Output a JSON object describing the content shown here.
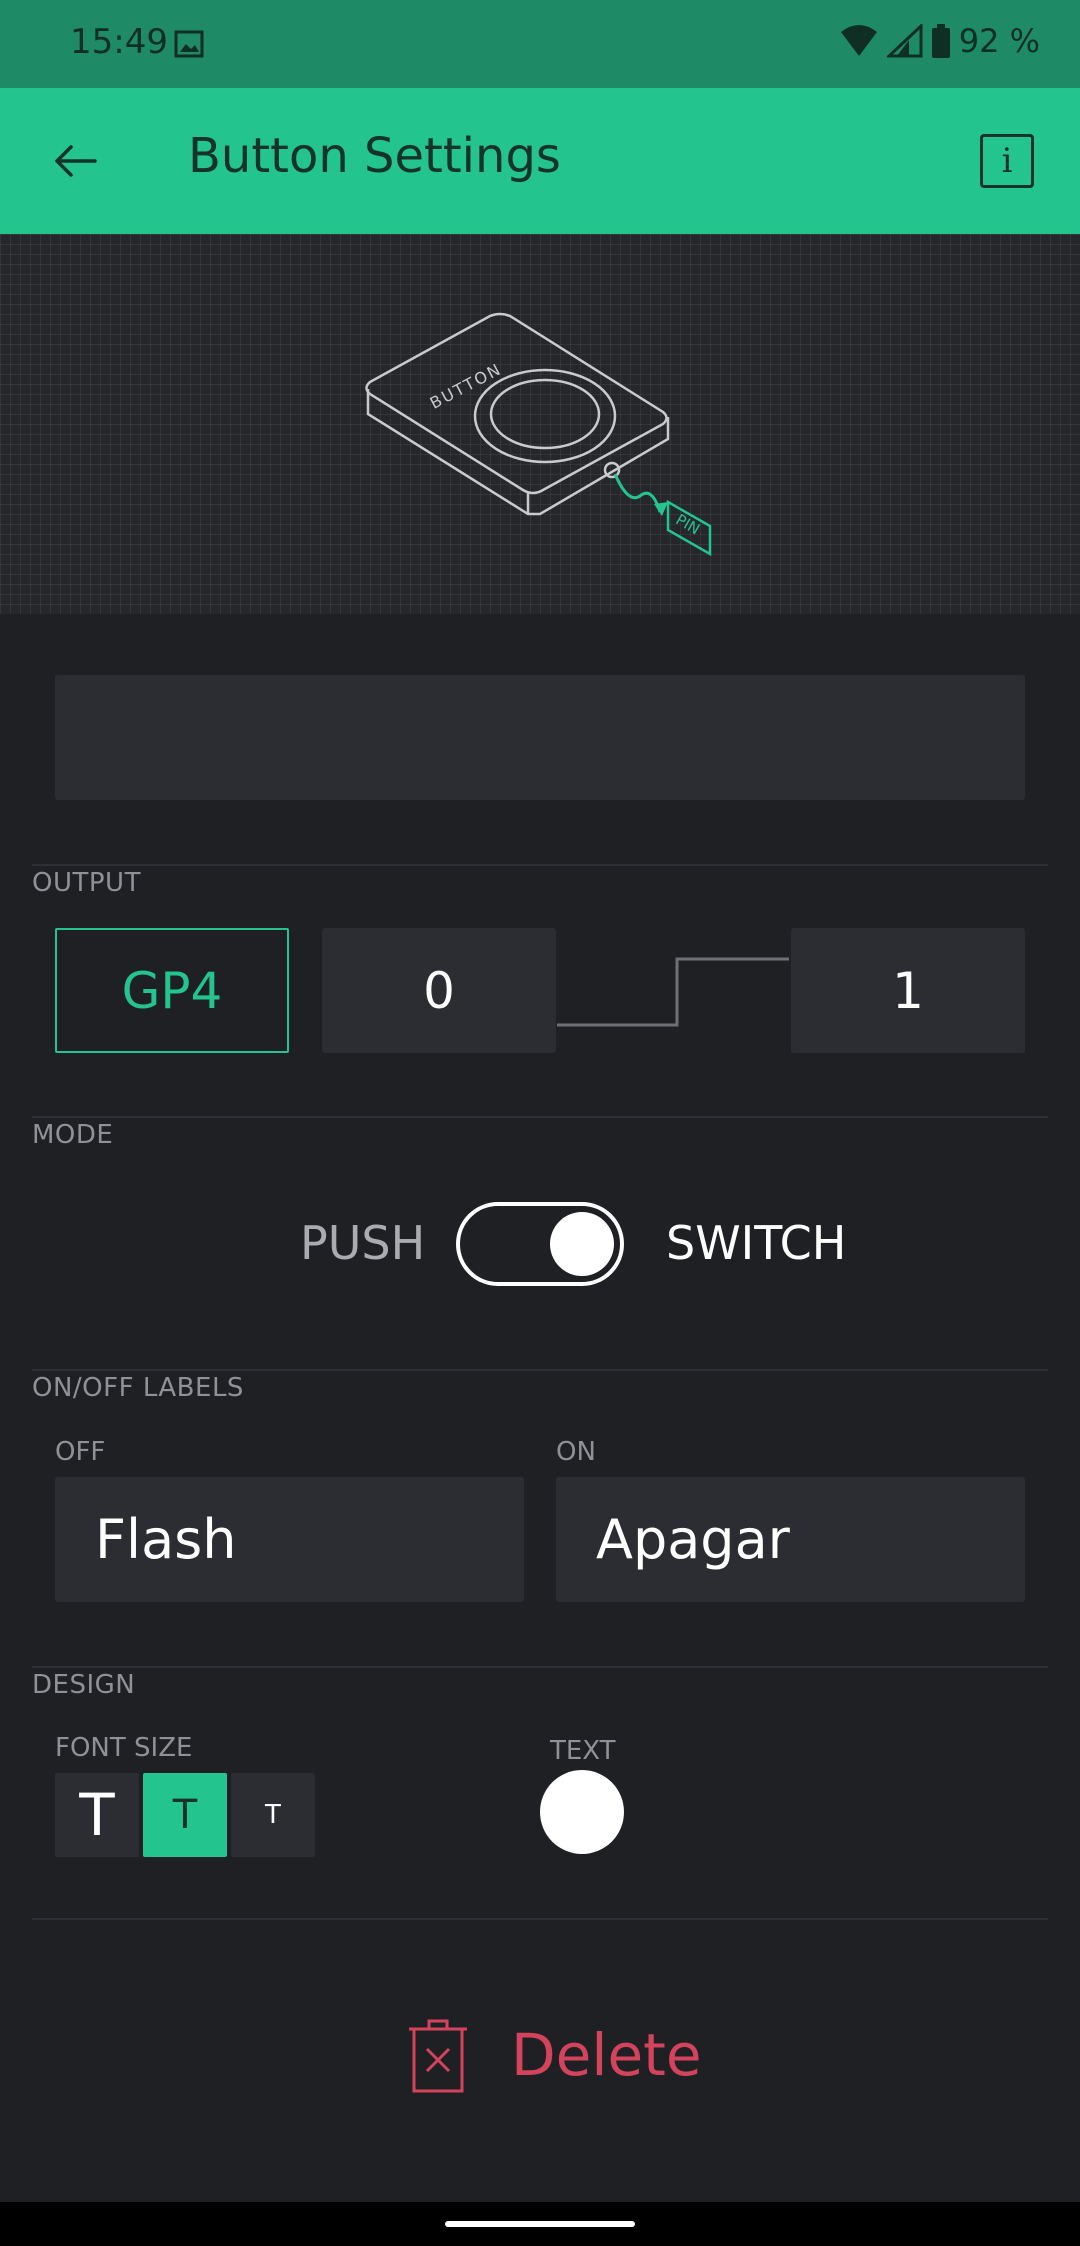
{
  "status_bar": {
    "time": "15:49",
    "battery": "92 %",
    "icons": [
      "image-icon",
      "wifi-icon",
      "signal-icon",
      "battery-icon"
    ]
  },
  "app_bar": {
    "title": "Button Settings",
    "back_icon": "arrow-left-icon",
    "info_label": "i"
  },
  "hero": {
    "button_text": "BUTTON",
    "pin_text": "PIN"
  },
  "name_field": {
    "value": "",
    "placeholder": ""
  },
  "output": {
    "section_label": "OUTPUT",
    "pin": "GP4",
    "low_value": "0",
    "high_value": "1"
  },
  "mode": {
    "section_label": "MODE",
    "push_label": "PUSH",
    "switch_label": "SWITCH",
    "selected": "SWITCH"
  },
  "labels": {
    "section_label": "ON/OFF LABELS",
    "off_label": "OFF",
    "off_value": "Flash",
    "on_label": "ON",
    "on_value": "Apagar"
  },
  "design": {
    "section_label": "DESIGN",
    "font_size_label": "FONT SIZE",
    "font_sizes": [
      "T",
      "T",
      "T"
    ],
    "selected_font_size": "medium",
    "text_color_label": "TEXT",
    "text_color": "#ffffff"
  },
  "delete": {
    "label": "Delete",
    "icon": "trash-icon"
  },
  "colors": {
    "accent": "#23c48e",
    "background": "#1f2024",
    "danger": "#d3435c"
  }
}
